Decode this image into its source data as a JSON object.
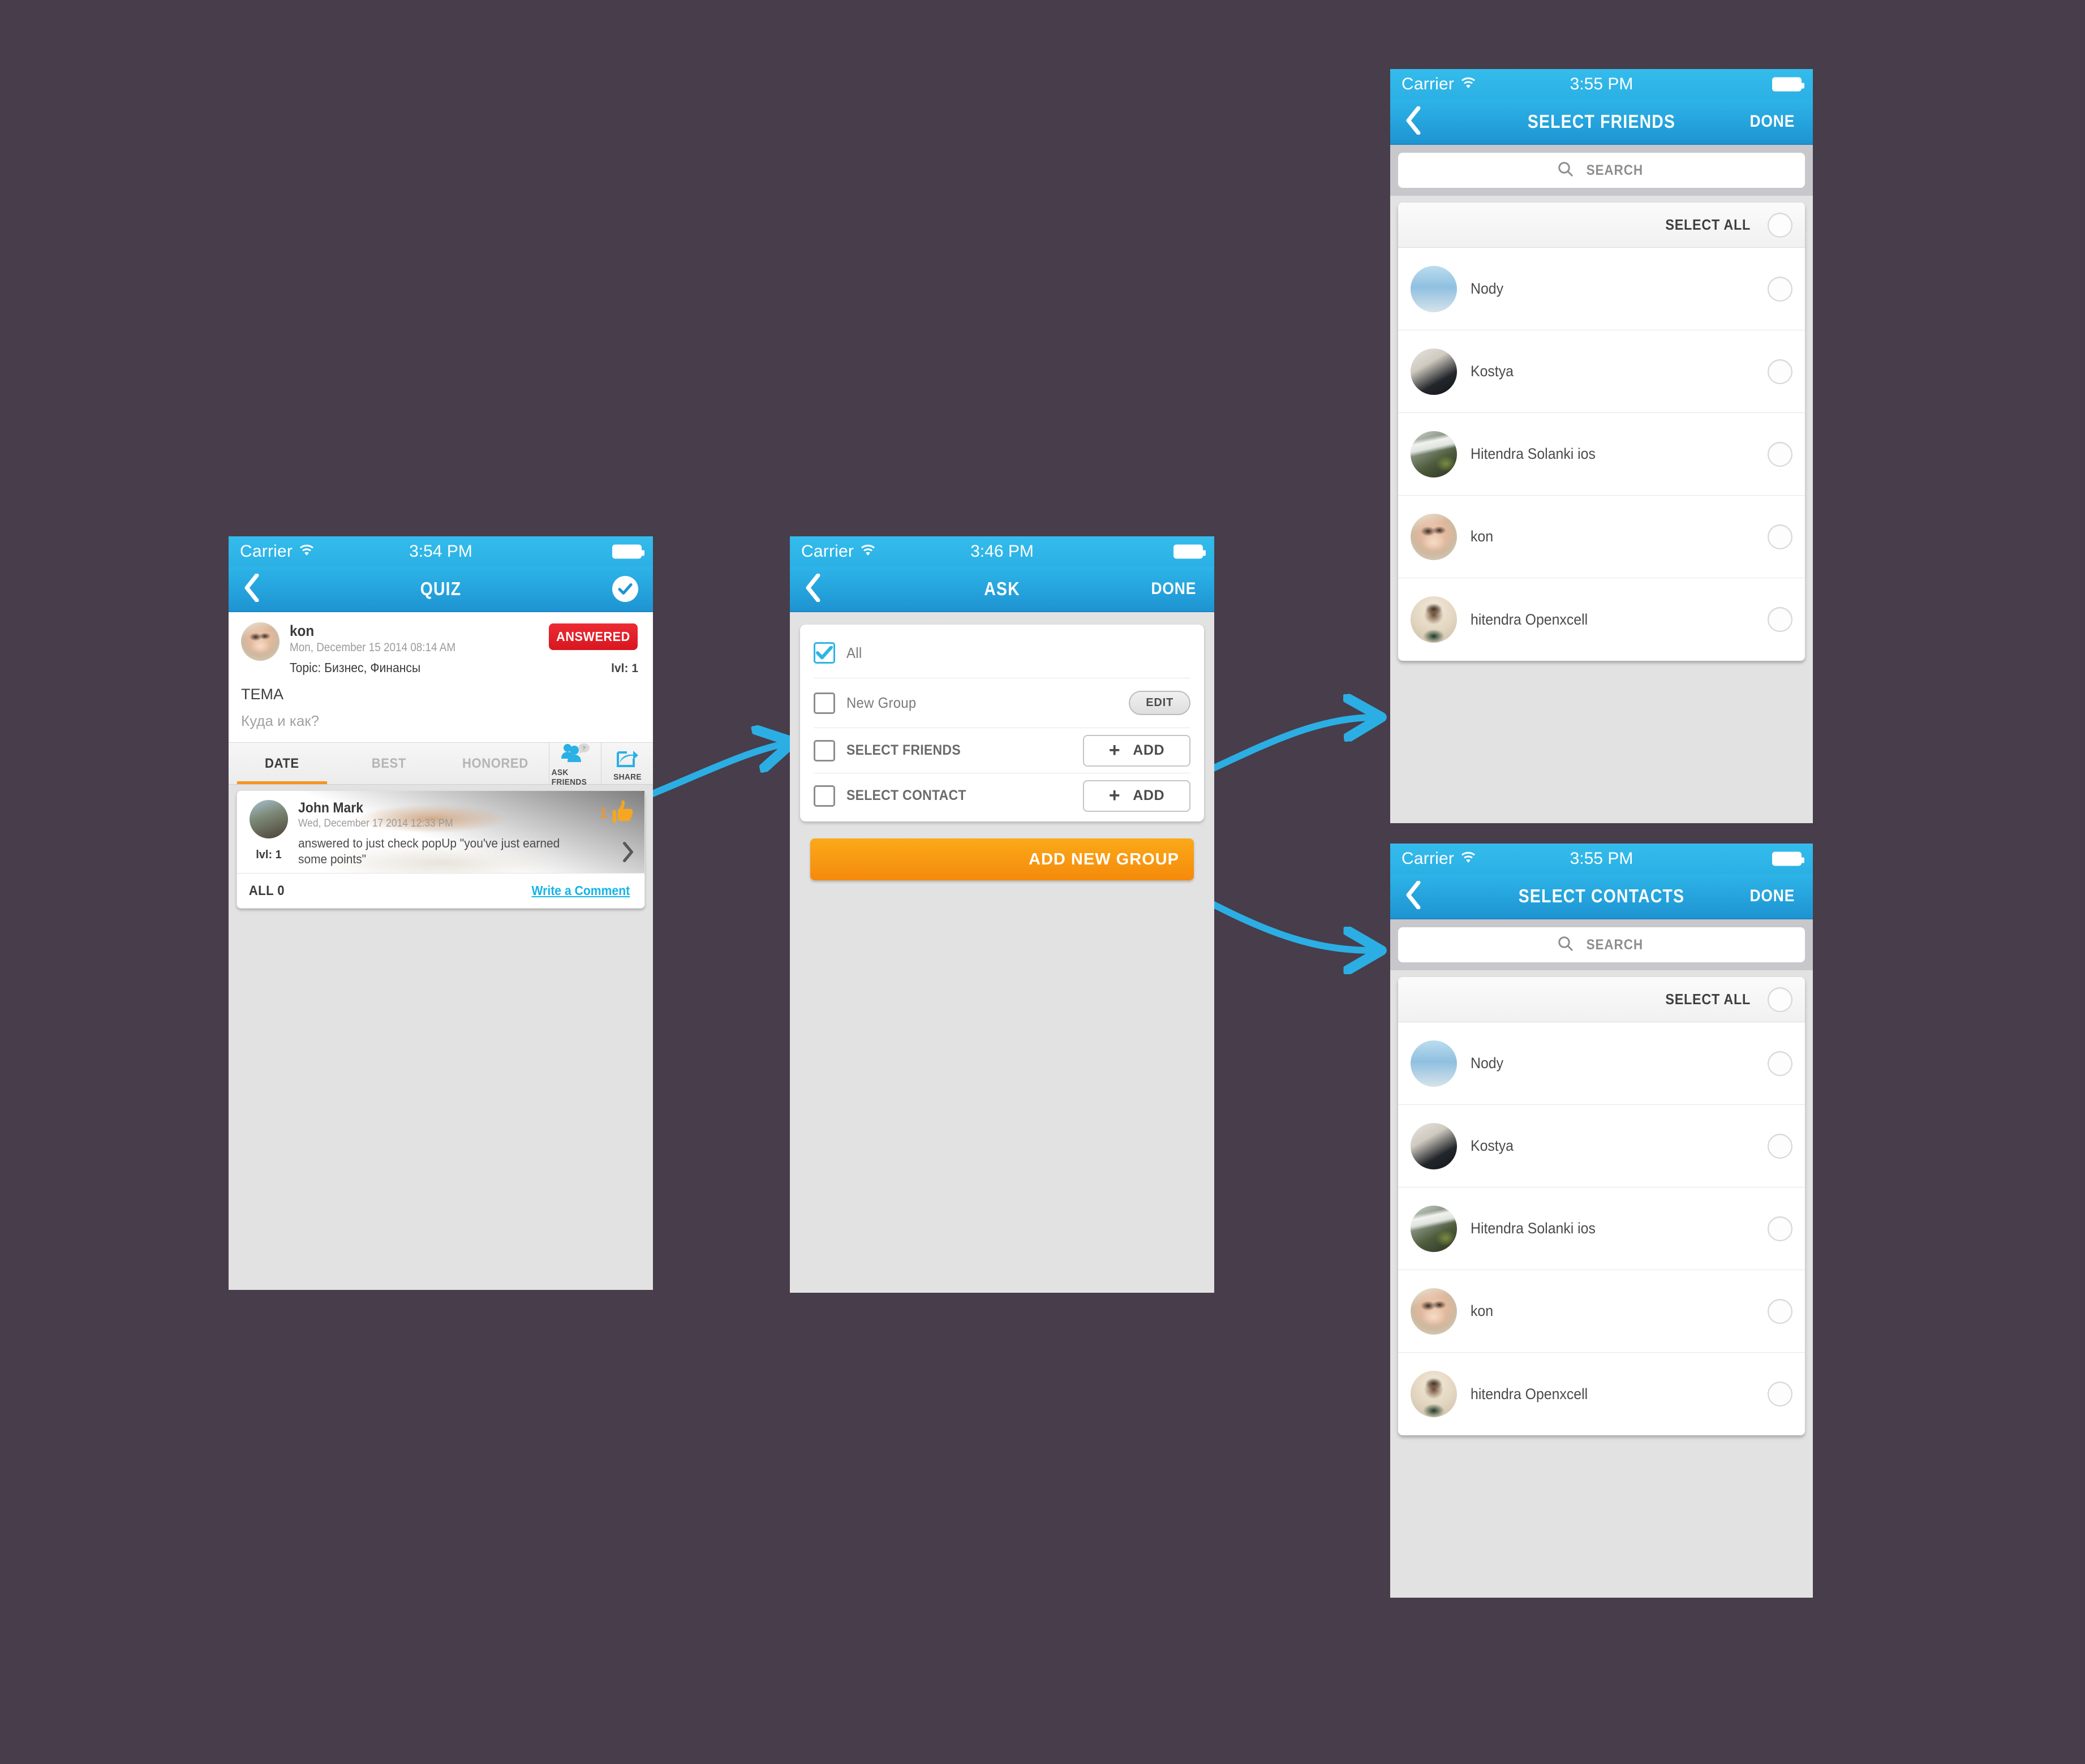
{
  "colors": {
    "canvas_bg": "#473D4B",
    "nav_blue": "#2DB4E8",
    "accent_orange": "#F79420",
    "accent_red": "#E0242C",
    "link_blue": "#14B4E8",
    "arrow_blue": "#2BAEE4"
  },
  "screens": {
    "quiz": {
      "status": {
        "carrier": "Carrier",
        "time": "3:54 PM"
      },
      "nav": {
        "title": "QUIZ",
        "back_icon": "chevron-left-icon",
        "right_icon": "check-circle-icon"
      },
      "post": {
        "author": "kon",
        "date": "Mon, December 15 2014 08:14 AM",
        "topic": "Topic: Бизнес, Финансы",
        "status_badge": "ANSWERED",
        "level": "lvl: 1",
        "title": "TEMA",
        "question": "Куда и как?"
      },
      "tabs": [
        {
          "label": "DATE",
          "active": true
        },
        {
          "label": "BEST",
          "active": false
        },
        {
          "label": "HONORED",
          "active": false
        }
      ],
      "tools": [
        {
          "label": "ASK FRIENDS",
          "icon": "ask-friends-icon"
        },
        {
          "label": "SHARE",
          "icon": "share-icon"
        }
      ],
      "answer": {
        "author": "John Mark",
        "date": "Wed, December 17 2014 12:33 PM",
        "text": "answered to just check popUp \"you've just earned some points\"",
        "level": "lvl: 1",
        "likes": "1"
      },
      "footer": {
        "all_count": "ALL 0",
        "write_comment": "Write a Comment"
      }
    },
    "ask": {
      "status": {
        "carrier": "Carrier",
        "time": "3:46 PM"
      },
      "nav": {
        "title": "ASK",
        "back_icon": "chevron-left-icon",
        "right_label": "DONE"
      },
      "options": [
        {
          "label": "All",
          "checked": true,
          "action": null
        },
        {
          "label": "New Group",
          "checked": false,
          "action": "EDIT"
        },
        {
          "label": "SELECT FRIENDS",
          "checked": false,
          "action": "ADD"
        },
        {
          "label": "SELECT CONTACT",
          "checked": false,
          "action": "ADD"
        }
      ],
      "primary_button": "ADD NEW GROUP"
    },
    "select_friends": {
      "status": {
        "carrier": "Carrier",
        "time": "3:55 PM"
      },
      "nav": {
        "title": "SELECT FRIENDS",
        "back_icon": "chevron-left-icon",
        "right_label": "DONE"
      },
      "search": {
        "placeholder": "SEARCH",
        "icon": "search-icon",
        "value": ""
      },
      "select_all_label": "SELECT ALL",
      "people": [
        {
          "name": "Nody",
          "avatar": "av-nody",
          "selected": false
        },
        {
          "name": "Kostya",
          "avatar": "av-kostya",
          "selected": false
        },
        {
          "name": "Hitendra Solanki ios",
          "avatar": "av-hitios",
          "selected": false
        },
        {
          "name": "kon",
          "avatar": "av-kon",
          "selected": false
        },
        {
          "name": "hitendra Openxcell",
          "avatar": "av-hitopen",
          "selected": false
        }
      ]
    },
    "select_contacts": {
      "status": {
        "carrier": "Carrier",
        "time": "3:55 PM"
      },
      "nav": {
        "title": "SELECT CONTACTS",
        "back_icon": "chevron-left-icon",
        "right_label": "DONE"
      },
      "search": {
        "placeholder": "SEARCH",
        "icon": "search-icon",
        "value": ""
      },
      "select_all_label": "SELECT ALL",
      "people": [
        {
          "name": "Nody",
          "avatar": "av-nody",
          "selected": false
        },
        {
          "name": "Kostya",
          "avatar": "av-kostya",
          "selected": false
        },
        {
          "name": "Hitendra Solanki ios",
          "avatar": "av-hitios",
          "selected": false
        },
        {
          "name": "kon",
          "avatar": "av-kon",
          "selected": false
        },
        {
          "name": "hitendra Openxcell",
          "avatar": "av-hitopen",
          "selected": false
        }
      ]
    }
  },
  "flow_arrows": [
    {
      "from": "quiz.ask-friends",
      "to": "ask"
    },
    {
      "from": "ask.select-friends-add",
      "to": "select_friends"
    },
    {
      "from": "ask.select-contact-add",
      "to": "select_contacts"
    }
  ]
}
